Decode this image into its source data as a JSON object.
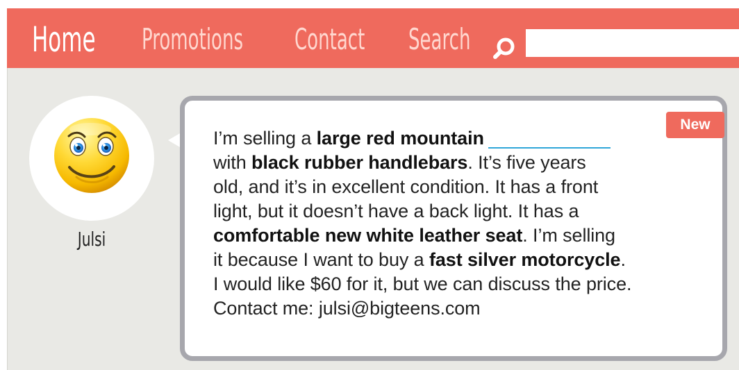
{
  "navigation": {
    "items": [
      {
        "label": "Home"
      },
      {
        "label": "Promotions"
      },
      {
        "label": "Contact"
      },
      {
        "label": "Search"
      }
    ],
    "search_icon": "magnifying-glass-icon"
  },
  "profile": {
    "username": "Julsi",
    "avatar_icon": "smiling-face-icon"
  },
  "post": {
    "badge": "New",
    "lines": [
      [
        {
          "text": "I’m selling a ",
          "bold": false
        },
        {
          "text": "large red mountain",
          "bold": true
        },
        {
          "text": "",
          "blank": true
        }
      ],
      [
        {
          "text": "with ",
          "bold": false
        },
        {
          "text": "black rubber handlebars",
          "bold": true
        },
        {
          "text": ". It’s five years",
          "bold": false
        }
      ],
      [
        {
          "text": "old, and it’s in excellent condition. It has a front",
          "bold": false
        }
      ],
      [
        {
          "text": "light, but it doesn’t have a back light. It has a",
          "bold": false
        }
      ],
      [
        {
          "text": "comfortable new white leather seat",
          "bold": true
        },
        {
          "text": ". I’m selling",
          "bold": false
        }
      ],
      [
        {
          "text": "it because I want to buy a ",
          "bold": false
        },
        {
          "text": "fast silver motorcycle",
          "bold": true
        },
        {
          "text": ".",
          "bold": false
        }
      ],
      [
        {
          "text": "I would like $60 for it, but we can discuss the price.",
          "bold": false
        }
      ],
      [
        {
          "text": "Contact me: julsi@bigteens.com",
          "bold": false
        }
      ]
    ]
  },
  "colors": {
    "accent": "#ef6a5d",
    "background": "#e9e9e5",
    "post_border": "#a7a7ad",
    "blank_underline": "#2ea6d8"
  }
}
